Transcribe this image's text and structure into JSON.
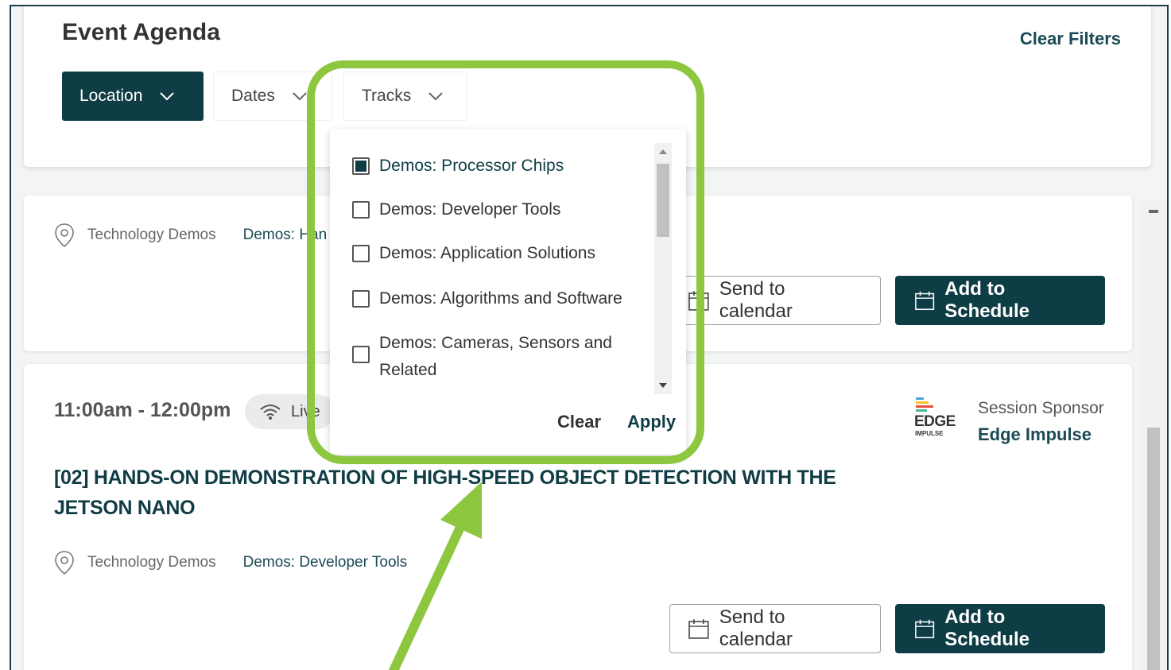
{
  "header": {
    "title": "Event Agenda",
    "clear_filters": "Clear Filters",
    "filters": [
      {
        "label": "Location",
        "active": true
      },
      {
        "label": "Dates",
        "active": false
      },
      {
        "label": "Tracks",
        "active": false
      }
    ]
  },
  "card1": {
    "location": "Technology Demos",
    "track": "Demos: Han",
    "send_to_calendar": "Send to calendar",
    "add_to_schedule": "Add to Schedule"
  },
  "card2": {
    "time": "11:00am - 12:00pm",
    "live_label": "Live",
    "title": "[02] HANDS-ON DEMONSTRATION OF HIGH-SPEED OBJECT DETECTION WITH THE JETSON NANO",
    "location": "Technology Demos",
    "track": "Demos: Developer Tools",
    "sponsor_label": "Session Sponsor",
    "sponsor_name": "Edge Impulse",
    "sponsor_logo_text": "EDGE",
    "sponsor_logo_subtext": "IMPULSE",
    "send_to_calendar": "Send to calendar",
    "add_to_schedule": "Add to Schedule"
  },
  "tracks_dropdown": {
    "options": [
      {
        "label": "Demos: Processor Chips",
        "checked": true
      },
      {
        "label": "Demos: Developer Tools",
        "checked": false
      },
      {
        "label": "Demos: Application Solutions",
        "checked": false
      },
      {
        "label": "Demos: Algorithms and Software",
        "checked": false
      },
      {
        "label": "Demos: Cameras, Sensors and Related",
        "checked": false
      }
    ],
    "clear": "Clear",
    "apply": "Apply"
  },
  "colors": {
    "primary": "#0f3d45",
    "highlight": "#8dc63f",
    "background": "#f3f4f5"
  }
}
